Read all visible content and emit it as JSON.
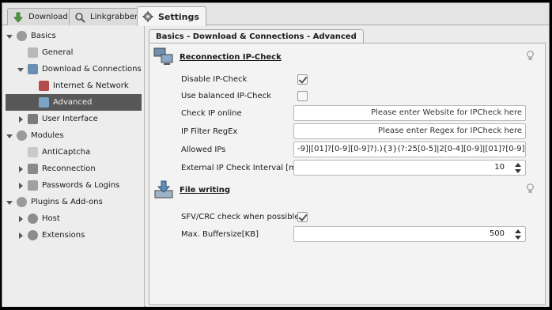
{
  "tabs": [
    {
      "label": "Download",
      "icon": "download-arrow-icon",
      "active": false
    },
    {
      "label": "Linkgrabber",
      "icon": "linkgrabber-icon",
      "active": false
    },
    {
      "label": "Settings",
      "icon": "gear-icon",
      "active": true
    }
  ],
  "sidebar": {
    "items": [
      {
        "label": "Basics",
        "icon": "gear-icon",
        "expanded": true,
        "level": 0
      },
      {
        "label": "General",
        "icon": "wrench-icon",
        "level": 1
      },
      {
        "label": "Download & Connections",
        "icon": "download-connections-icon",
        "expanded": true,
        "level": 1
      },
      {
        "label": "Internet & Network",
        "icon": "network-icon",
        "level": 2
      },
      {
        "label": "Advanced",
        "icon": "advanced-network-icon",
        "level": 2,
        "selected": true
      },
      {
        "label": "User Interface",
        "icon": "monitor-icon",
        "expanded": false,
        "level": 1
      },
      {
        "label": "Modules",
        "icon": "gear-icon",
        "expanded": true,
        "level": 0
      },
      {
        "label": "AntiCaptcha",
        "icon": "captcha-icon",
        "level": 1
      },
      {
        "label": "Reconnection",
        "icon": "reconnect-icon",
        "expanded": false,
        "level": 1
      },
      {
        "label": "Passwords & Logins",
        "icon": "password-icon",
        "expanded": false,
        "level": 1
      },
      {
        "label": "Plugins & Add-ons",
        "icon": "gear-icon",
        "expanded": true,
        "level": 0
      },
      {
        "label": "Host",
        "icon": "host-icon",
        "expanded": false,
        "level": 1
      },
      {
        "label": "Extensions",
        "icon": "extensions-icon",
        "expanded": false,
        "level": 1
      }
    ]
  },
  "content": {
    "panel_tab": "Basics - Download & Connections - Advanced",
    "reconnection": {
      "title": "Reconnection IP-Check",
      "disable_ipcheck_label": "Disable IP-Check",
      "disable_ipcheck_checked": true,
      "balanced_label": "Use balanced IP-Check",
      "balanced_checked": false,
      "check_ip_online_label": "Check IP online",
      "check_ip_online_placeholder": "Please enter Website for IPCheck here",
      "ip_filter_label": "IP Filter RegEx",
      "ip_filter_placeholder": "Please enter Regex for IPCheck here",
      "allowed_ips_label": "Allowed IPs",
      "allowed_ips_value": "-9]|[01]?[0-9][0-9]?).){3}(?:25[0-5]|2[0-4][0-9]|[01]?[0-9][0-9]?)\\b",
      "interval_label": "External IP Check Interval [min]",
      "interval_value": "10"
    },
    "file_writing": {
      "title": "File writing",
      "sfv_label": "SFV/CRC check when possible",
      "sfv_checked": true,
      "buffer_label": "Max. Buffersize[KB]",
      "buffer_value": "500"
    }
  }
}
